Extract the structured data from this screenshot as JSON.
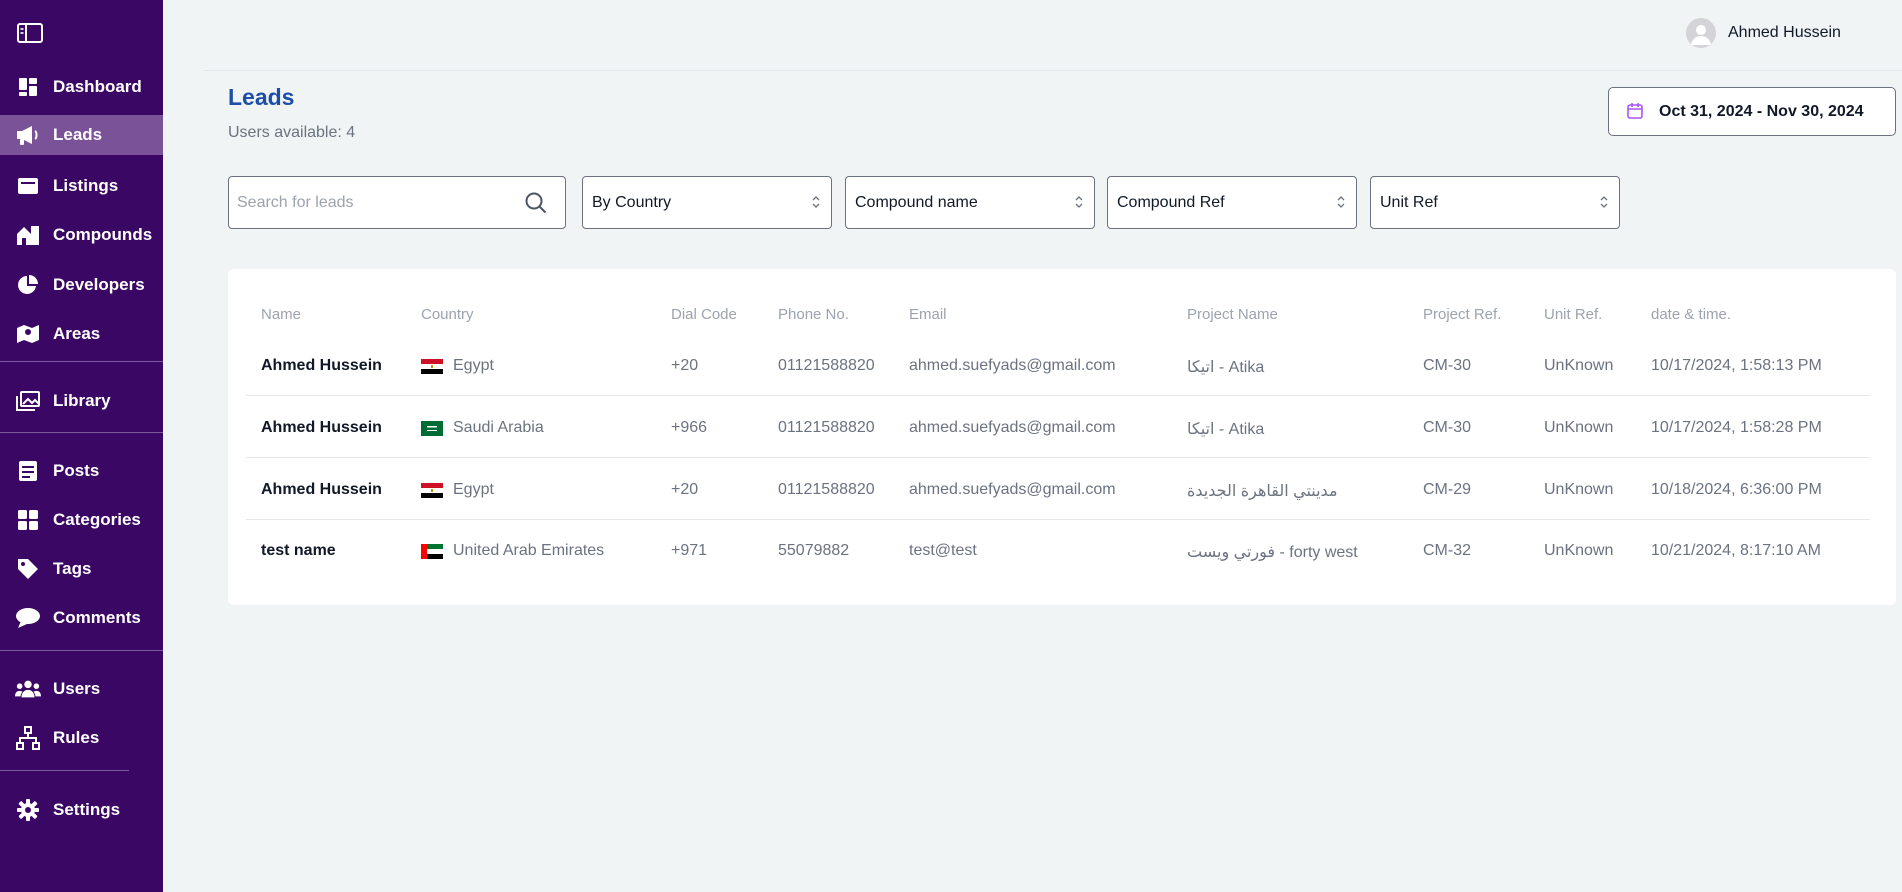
{
  "sidebar": {
    "items": [
      {
        "label": "Dashboard",
        "icon": "dashboard-icon"
      },
      {
        "label": "Leads",
        "icon": "megaphone-icon",
        "active": true
      },
      {
        "label": "Listings",
        "icon": "listings-icon"
      },
      {
        "label": "Compounds",
        "icon": "compounds-icon"
      },
      {
        "label": "Developers",
        "icon": "pie-chart-icon"
      },
      {
        "label": "Areas",
        "icon": "map-icon"
      },
      {
        "label": "Library",
        "icon": "image-gallery-icon"
      },
      {
        "label": "Posts",
        "icon": "document-icon"
      },
      {
        "label": "Categories",
        "icon": "grid-icon"
      },
      {
        "label": "Tags",
        "icon": "tag-icon"
      },
      {
        "label": "Comments",
        "icon": "comment-icon"
      },
      {
        "label": "Users",
        "icon": "users-icon"
      },
      {
        "label": "Rules",
        "icon": "sitemap-icon"
      },
      {
        "label": "Settings",
        "icon": "gear-icon"
      }
    ]
  },
  "header": {
    "user_name": "Ahmed Hussein"
  },
  "page": {
    "title": "Leads",
    "users_available": "Users available: 4",
    "date_range": "Oct 31, 2024 - Nov 30, 2024"
  },
  "filters": {
    "search_placeholder": "Search for leads",
    "country": "By Country",
    "compound_name": "Compound name",
    "compound_ref": "Compound Ref",
    "unit_ref": "Unit Ref"
  },
  "table": {
    "headers": [
      "Name",
      "Country",
      "Dial Code",
      "Phone No.",
      "Email",
      "Project Name",
      "Project Ref.",
      "Unit Ref.",
      "date & time."
    ],
    "rows": [
      {
        "name": "Ahmed Hussein",
        "country": "Egypt",
        "flag": "egypt",
        "dial": "+20",
        "phone": "01121588820",
        "email": "ahmed.suefyads@gmail.com",
        "project": "اتيكا - Atika",
        "project_ref": "CM-30",
        "unit_ref": "UnKnown",
        "datetime": "10/17/2024, 1:58:13 PM"
      },
      {
        "name": "Ahmed Hussein",
        "country": "Saudi Arabia",
        "flag": "saudi-arabia",
        "dial": "+966",
        "phone": "01121588820",
        "email": "ahmed.suefyads@gmail.com",
        "project": "اتيكا - Atika",
        "project_ref": "CM-30",
        "unit_ref": "UnKnown",
        "datetime": "10/17/2024, 1:58:28 PM"
      },
      {
        "name": "Ahmed Hussein",
        "country": "Egypt",
        "flag": "egypt",
        "dial": "+20",
        "phone": "01121588820",
        "email": "ahmed.suefyads@gmail.com",
        "project": "مدينتي القاهرة الجديدة",
        "project_ref": "CM-29",
        "unit_ref": "UnKnown",
        "datetime": "10/18/2024, 6:36:00 PM"
      },
      {
        "name": "test name",
        "country": "United Arab Emirates",
        "flag": "uae",
        "dial": "+971",
        "phone": "55079882",
        "email": "test@test",
        "project": "فورتي ويست - forty west",
        "project_ref": "CM-32",
        "unit_ref": "UnKnown",
        "datetime": "10/21/2024, 8:17:10 AM"
      }
    ]
  },
  "colors": {
    "sidebar_bg": "#3b0764",
    "sidebar_active": "#7a5297",
    "title_blue": "#1e4fa8",
    "calendar_purple": "#a855f7"
  }
}
